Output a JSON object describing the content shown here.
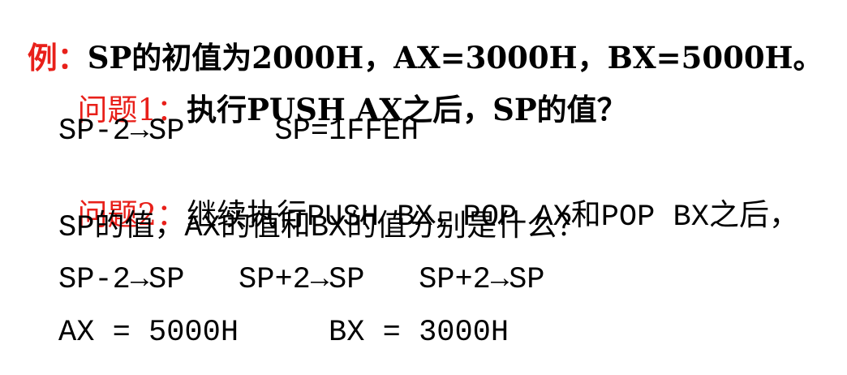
{
  "example": {
    "label": "例：",
    "text": "SP的初值为2000H，AX=3000H，BX=5000H。"
  },
  "q1": {
    "label": "问题1：",
    "text": "执行PUSH AX之后，SP的值？",
    "answer": "SP-2→SP     SP=1FFEH"
  },
  "q2": {
    "label": "问题2：",
    "text_line1": "继续执行PUSH BX，POP AX和POP BX之后，",
    "text_line2": "SP的值，AX的值和BX的值分别是什么？",
    "answer_line1": "SP-2→SP   SP+2→SP   SP+2→SP",
    "answer_line2": "AX = 5000H     BX = 3000H"
  },
  "colors": {
    "accent_red": "#e8201a",
    "text": "#000000"
  }
}
